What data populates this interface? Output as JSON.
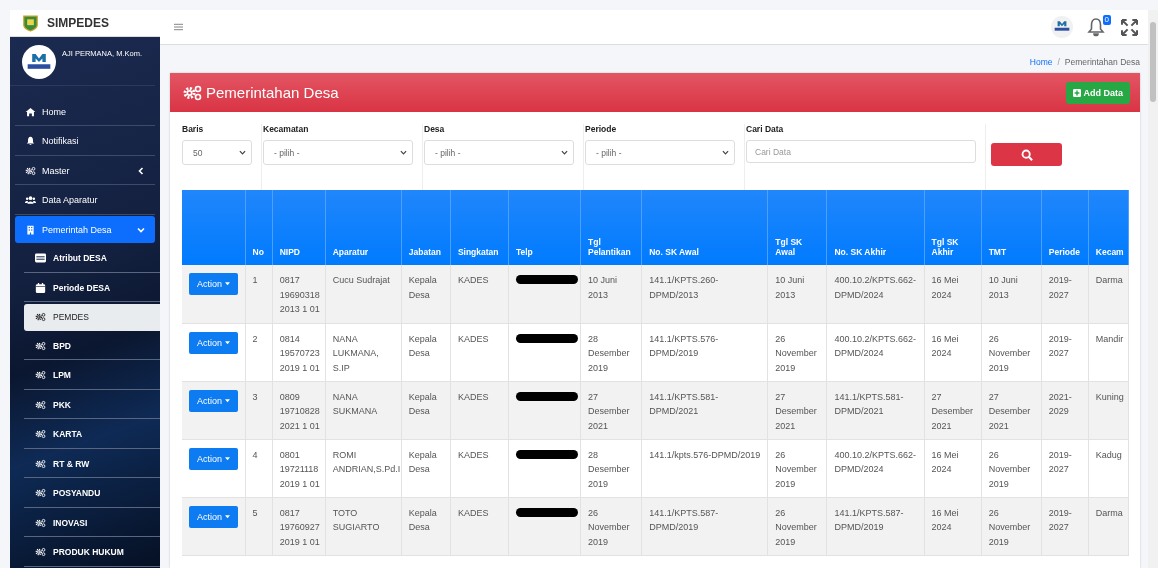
{
  "brand": {
    "title": "SIMPEDES"
  },
  "user": {
    "name": "AJI PERMANA, M.Kom."
  },
  "sidebar": {
    "items": [
      {
        "label": "Home",
        "kind": "link",
        "selected": false
      },
      {
        "label": "Notifikasi",
        "kind": "link",
        "selected": false
      },
      {
        "label": "Master",
        "kind": "group",
        "selected": false,
        "expanded": false
      },
      {
        "label": "Data Aparatur",
        "kind": "link",
        "selected": false
      },
      {
        "label": "Pemerintah Desa",
        "kind": "group",
        "selected": true,
        "expanded": true,
        "children": [
          {
            "label": "Atribut DESA",
            "selected": false
          },
          {
            "label": "Periode DESA",
            "selected": false
          },
          {
            "label": "PEMDES",
            "selected": true
          },
          {
            "label": "BPD",
            "selected": false
          },
          {
            "label": "LPM",
            "selected": false
          },
          {
            "label": "PKK",
            "selected": false
          },
          {
            "label": "KARTA",
            "selected": false
          },
          {
            "label": "RT & RW",
            "selected": false
          },
          {
            "label": "POSYANDU",
            "selected": false
          },
          {
            "label": "INOVASI",
            "selected": false
          },
          {
            "label": "PRODUK HUKUM",
            "selected": false
          }
        ]
      }
    ]
  },
  "topbar": {
    "notification_count": "0"
  },
  "breadcrumb": [
    {
      "label": "Home",
      "kind": "link"
    },
    {
      "label": "/",
      "kind": "separator"
    },
    {
      "label": "Pemerintahan Desa",
      "kind": "current"
    }
  ],
  "card": {
    "title": "Pemerintahan Desa",
    "add_button": "Add Data"
  },
  "filters": [
    {
      "label": "Baris",
      "kind": "select",
      "value": "50"
    },
    {
      "label": "Kecamatan",
      "kind": "select",
      "value": "- pilih -"
    },
    {
      "label": "Desa",
      "kind": "select",
      "value": "- pilih -"
    },
    {
      "label": "Periode",
      "kind": "select",
      "value": "- pilih -"
    },
    {
      "label": "Cari Data",
      "kind": "input",
      "placeholder": "Cari Data"
    }
  ],
  "table": {
    "columns": [
      {
        "kind": "action"
      },
      {
        "label": "No",
        "kind": "text"
      },
      {
        "label": "NIPD",
        "kind": "text"
      },
      {
        "label": "Aparatur",
        "kind": "text"
      },
      {
        "label": "Jabatan",
        "kind": "text"
      },
      {
        "label": "Singkatan",
        "kind": "text"
      },
      {
        "label": "Telp",
        "kind": "redacted"
      },
      {
        "label": "Tgl Pelantikan",
        "kind": "text"
      },
      {
        "label": "No. SK Awal",
        "kind": "text"
      },
      {
        "label": "Tgl SK Awal",
        "kind": "text"
      },
      {
        "label": "No. SK Akhir",
        "kind": "text"
      },
      {
        "label": "Tgl SK Akhir",
        "kind": "text"
      },
      {
        "label": "TMT",
        "kind": "text"
      },
      {
        "label": "Periode",
        "kind": "text"
      },
      {
        "label": "Kecam",
        "kind": "text"
      }
    ],
    "rows": [
      {
        "cells": [
          "Action",
          "1",
          "0817 19690318 2013 1 01",
          "Cucu Sudrajat",
          "Kepala Desa",
          "KADES",
          "",
          "10 Juni 2013",
          "141.1/KPTS.260-DPMD/2013",
          "10 Juni 2013",
          "400.10.2/KPTS.662-DPMD/2024",
          "16 Mei 2024",
          "10 Juni 2013",
          "2019-2027",
          "Darma"
        ],
        "telp_redacted": true
      },
      {
        "cells": [
          "Action",
          "2",
          "0814 19570723 2019 1 01",
          "NANA LUKMANA, S.IP",
          "Kepala Desa",
          "KADES",
          "",
          "28 Desember 2019",
          "141.1/KPTS.576-DPMD/2019",
          "26 November 2019",
          "400.10.2/KPTS.662-DPMD/2024",
          "16 Mei 2024",
          "26 November 2019",
          "2019-2027",
          "Mandir"
        ],
        "telp_redacted": true
      },
      {
        "cells": [
          "Action",
          "3",
          "0809 19710828 2021 1 01",
          "NANA SUKMANA",
          "Kepala Desa",
          "KADES",
          "",
          "27 Desember 2021",
          "141.1/KPTS.581-DPMD/2021",
          "27 Desember 2021",
          "141.1/KPTS.581-DPMD/2021",
          "27 Desember 2021",
          "27 Desember 2021",
          "2021-2029",
          "Kuning"
        ],
        "telp_redacted": true
      },
      {
        "cells": [
          "Action",
          "4",
          "0801 19721118 2019 1 01",
          "ROMI ANDRIAN,S.Pd.I",
          "Kepala Desa",
          "KADES",
          "",
          "28 Desember 2019",
          "141.1/kpts.576-DPMD/2019",
          "26 November 2019",
          "400.10.2/KPTS.662-DPMD/2024",
          "16 Mei 2024",
          "26 November 2019",
          "2019-2027",
          "Kadug"
        ],
        "telp_redacted": true
      },
      {
        "cells": [
          "Action",
          "5",
          "0817 19760927 2019 1 01",
          "TOTO SUGIARTO",
          "Kepala Desa",
          "KADES",
          "",
          "26 November 2019",
          "141.1/KPTS.587-DPMD/2019",
          "26 November 2019",
          "141.1/KPTS.587-DPMD/2019",
          "16 Mei 2024",
          "26 November 2019",
          "2019-2027",
          "Darma"
        ],
        "telp_redacted": true
      }
    ]
  }
}
